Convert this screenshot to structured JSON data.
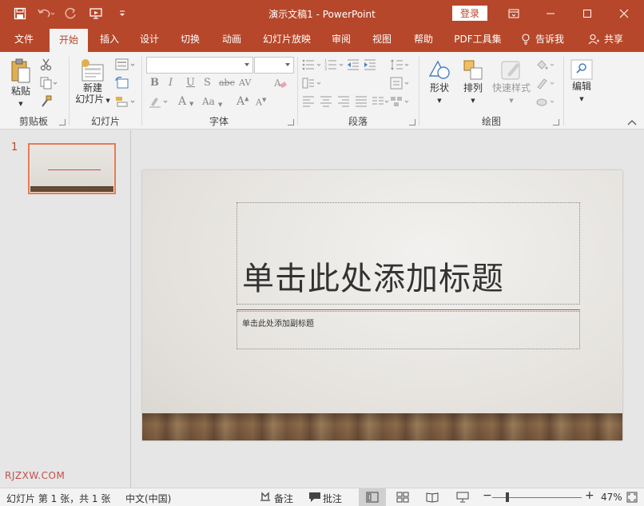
{
  "app": {
    "title": "演示文稿1  -  PowerPoint",
    "login_label": "登录"
  },
  "tabs": [
    {
      "label": "文件"
    },
    {
      "label": "开始"
    },
    {
      "label": "插入"
    },
    {
      "label": "设计"
    },
    {
      "label": "切换"
    },
    {
      "label": "动画"
    },
    {
      "label": "幻灯片放映"
    },
    {
      "label": "审阅"
    },
    {
      "label": "视图"
    },
    {
      "label": "帮助"
    },
    {
      "label": "PDF工具集"
    },
    {
      "label": "告诉我"
    },
    {
      "label": "共享"
    }
  ],
  "ribbon": {
    "clipboard": {
      "paste_label": "粘贴",
      "group_label": "剪贴板"
    },
    "slides": {
      "new_slide_line1": "新建",
      "new_slide_line2": "幻灯片",
      "group_label": "幻灯片"
    },
    "font": {
      "group_label": "字体",
      "bold": "B",
      "italic": "I",
      "underline": "U",
      "shadow": "S",
      "strike": "abc",
      "spacing": "AV",
      "case": "Aa",
      "grow": "A",
      "shrink": "A"
    },
    "paragraph": {
      "group_label": "段落"
    },
    "drawing": {
      "shape_label": "形状",
      "arrange_label": "排列",
      "quick_styles_label": "快速样式",
      "group_label": "绘图"
    },
    "editing": {
      "edit_label": "编辑"
    }
  },
  "thumbnails": [
    {
      "number": "1"
    }
  ],
  "slide": {
    "title_placeholder": "单击此处添加标题",
    "subtitle_placeholder": "单击此处添加副标题"
  },
  "watermark": "RJZXW.COM",
  "status": {
    "slide_info": "幻灯片 第 1 张，共 1 张",
    "language": "中文(中国)",
    "notes_label": "备注",
    "comments_label": "批注",
    "zoom": "47%"
  },
  "colors": {
    "accent": "#b7472a",
    "thumb_border": "#e57a55",
    "title_line": "#c0504d"
  }
}
